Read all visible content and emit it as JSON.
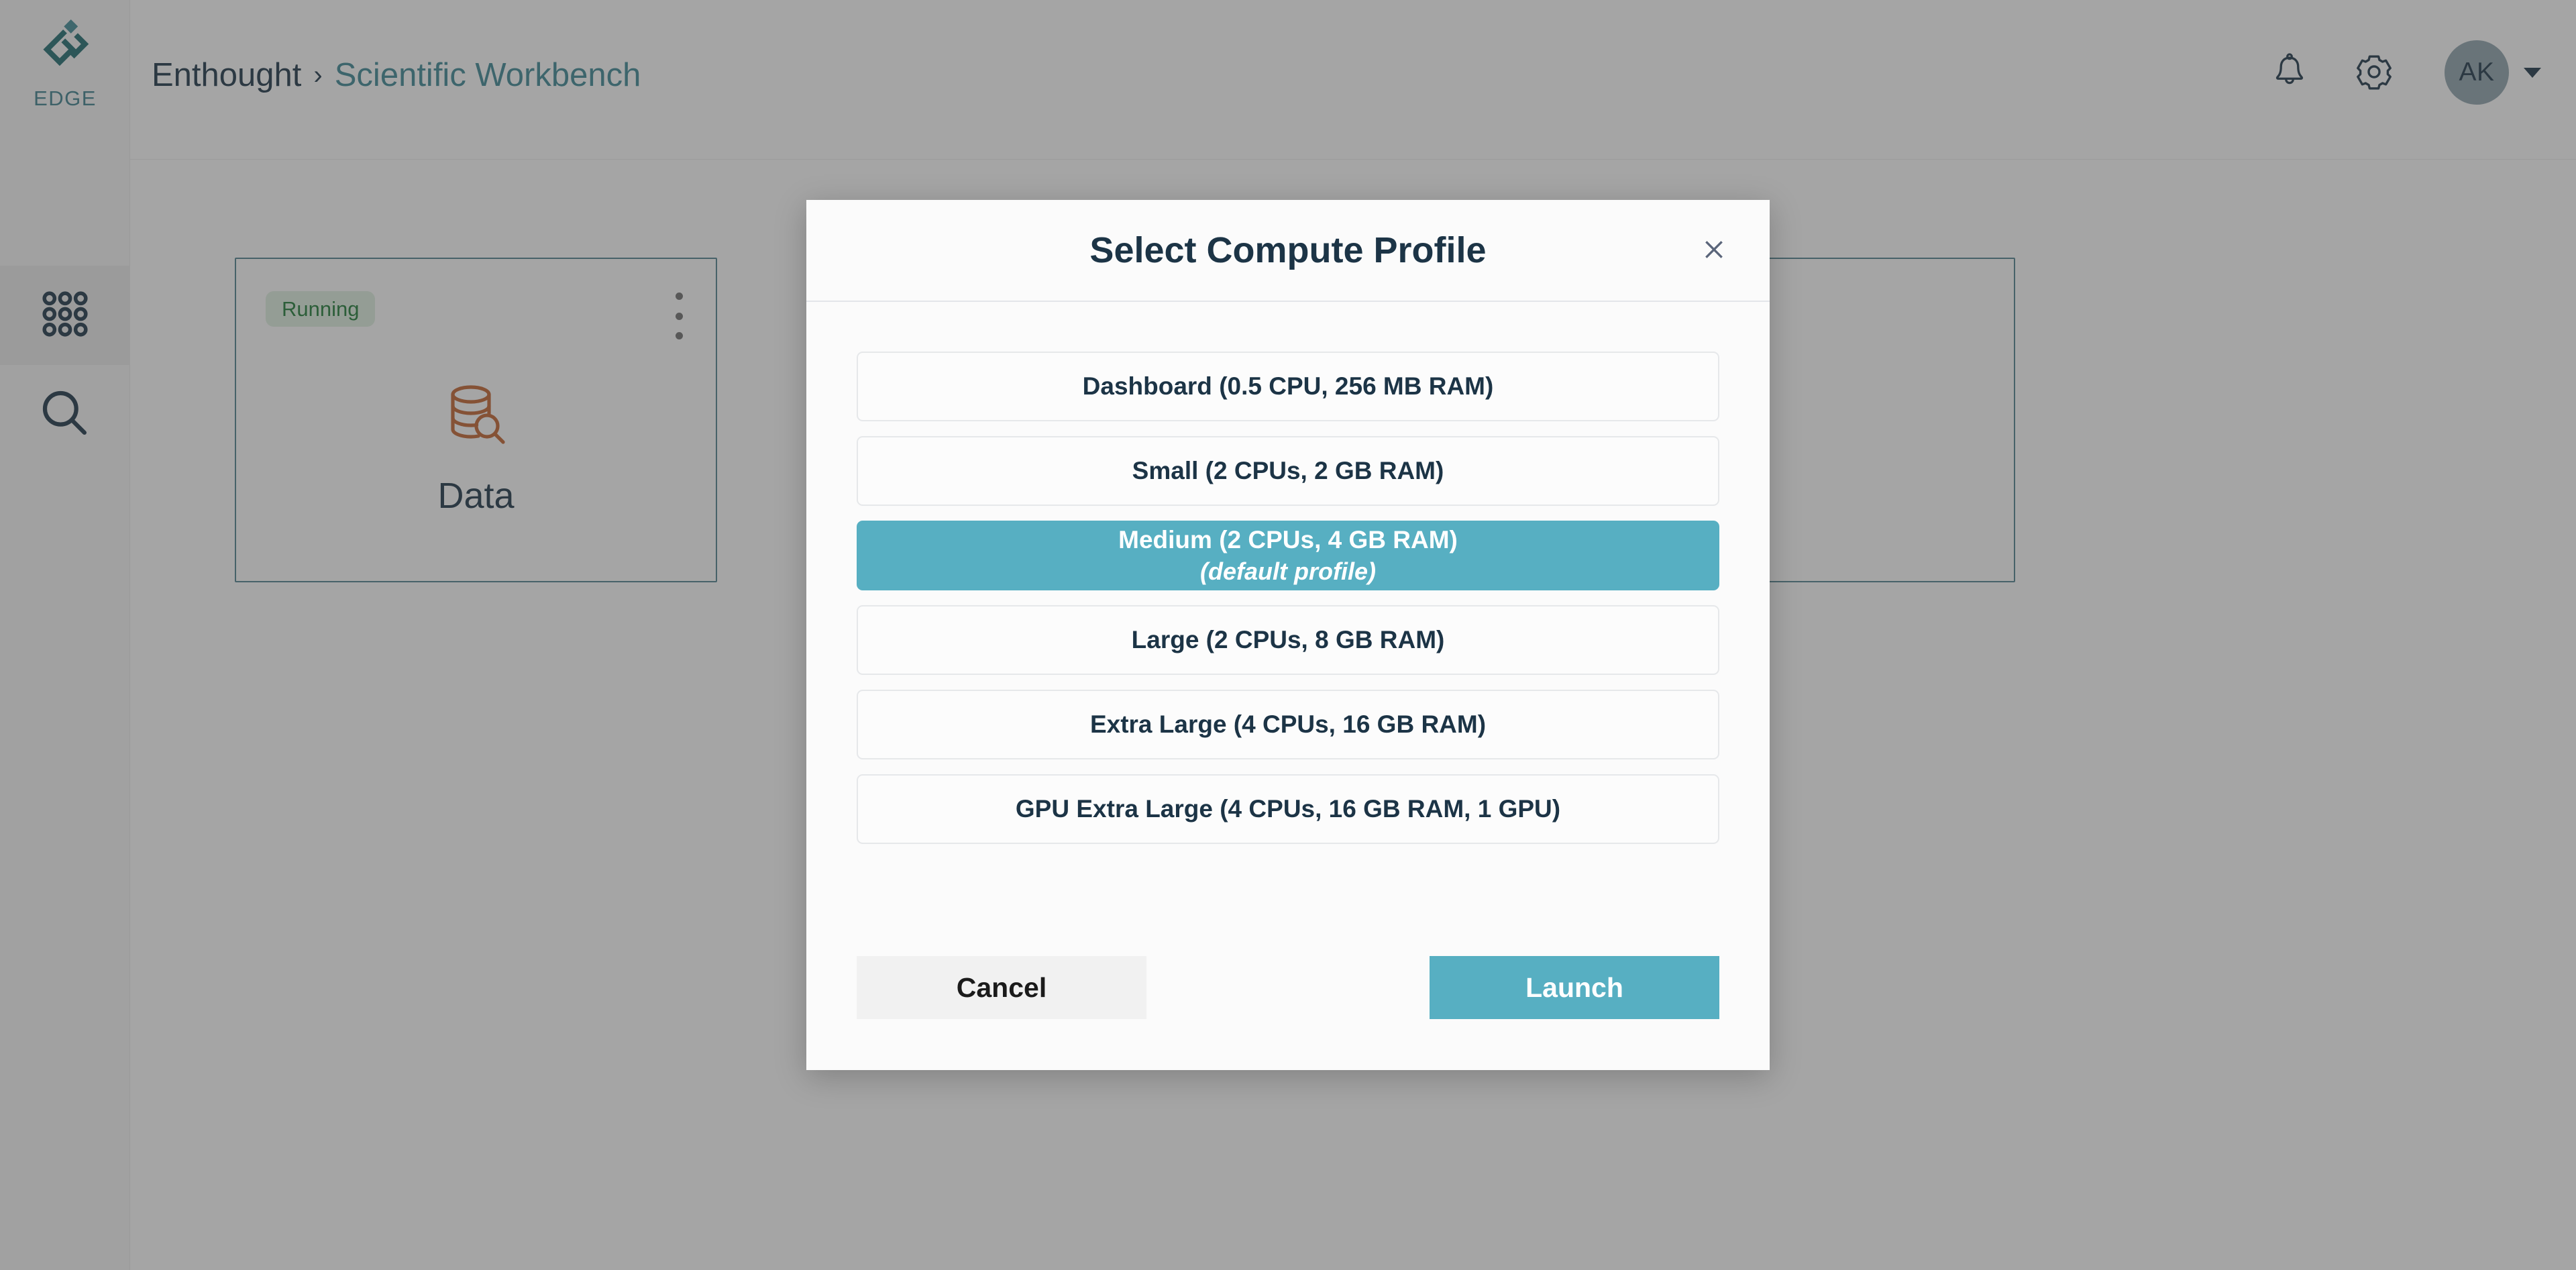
{
  "brand": {
    "logo_icon": "edge-diamond-logo-icon",
    "wordmark": "EDGE",
    "logo_color": "#1d6b6e",
    "wordmark_color": "#3c7f8c"
  },
  "sidebar": {
    "items": [
      {
        "name": "apps",
        "icon": "grid-apps-icon",
        "active": true
      },
      {
        "name": "search",
        "icon": "search-icon",
        "active": false
      }
    ]
  },
  "header": {
    "breadcrumb": {
      "root": "Enthought",
      "separator": "›",
      "leaf": "Scientific Workbench"
    },
    "actions": {
      "notifications_icon": "bell-icon",
      "settings_icon": "gear-icon",
      "avatar_initials": "AK",
      "avatar_caret_icon": "chevron-down-icon"
    }
  },
  "main": {
    "cards": [
      {
        "status": "Running",
        "title": "Data",
        "icon": "database-search-icon",
        "icon_color": "#c2622f",
        "menu_icon": "kebab-menu-icon"
      },
      {
        "status": "",
        "title": "",
        "icon": "",
        "icon_color": "",
        "menu_icon": ""
      }
    ]
  },
  "modal": {
    "title": "Select Compute Profile",
    "close_icon": "close-icon",
    "selected_index": 2,
    "accent_color": "#57afc2",
    "options": [
      {
        "label": "Dashboard (0.5 CPU, 256 MB RAM)",
        "sub": ""
      },
      {
        "label": "Small (2 CPUs, 2 GB RAM)",
        "sub": ""
      },
      {
        "label": "Medium (2 CPUs, 4 GB RAM)",
        "sub": "(default profile)"
      },
      {
        "label": "Large (2 CPUs, 8 GB RAM)",
        "sub": ""
      },
      {
        "label": "Extra Large (4 CPUs, 16 GB RAM)",
        "sub": ""
      },
      {
        "label": "GPU Extra Large (4 CPUs, 16 GB RAM, 1 GPU)",
        "sub": ""
      }
    ],
    "cancel_label": "Cancel",
    "launch_label": "Launch"
  }
}
